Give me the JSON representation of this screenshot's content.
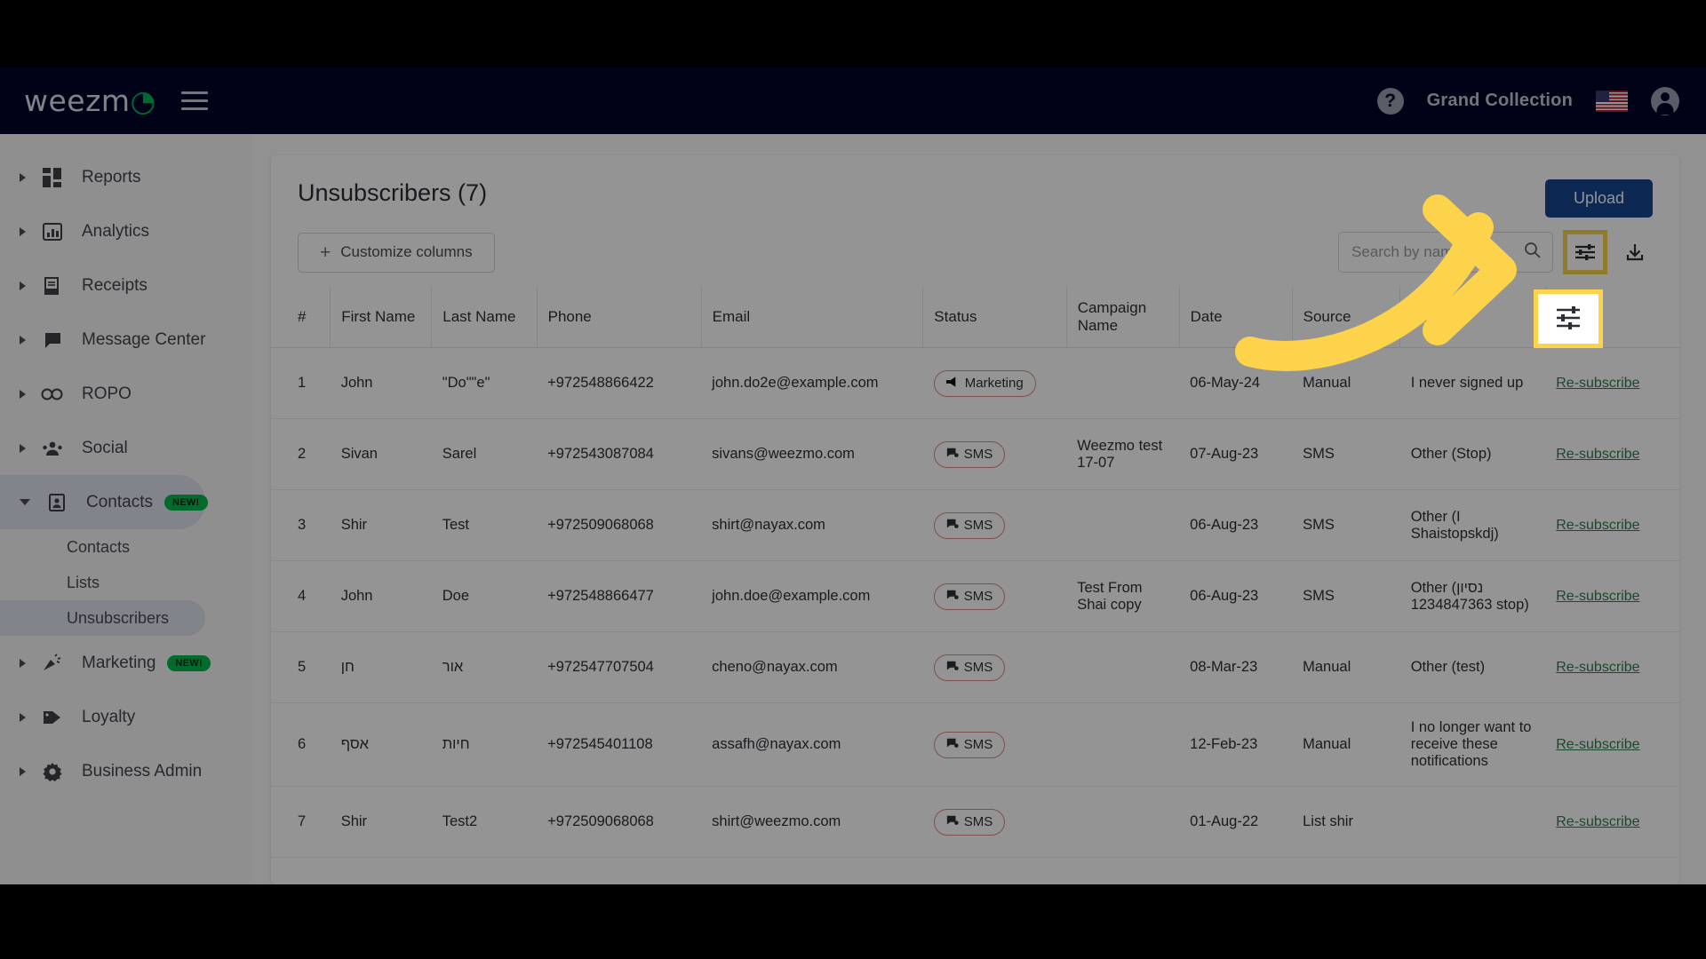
{
  "appbar": {
    "logo_text": "weezm",
    "logo_accent": "◔",
    "menu_icon": "hamburger-icon",
    "help_label": "?",
    "company": "Grand Collection",
    "flag": "us-flag",
    "account_icon": "account-icon"
  },
  "sidebar": {
    "items": [
      {
        "label": "Reports",
        "icon": "dashboard-icon",
        "expanded": false,
        "badge": ""
      },
      {
        "label": "Analytics",
        "icon": "bar-chart-icon",
        "expanded": false,
        "badge": ""
      },
      {
        "label": "Receipts",
        "icon": "receipt-icon",
        "expanded": false,
        "badge": ""
      },
      {
        "label": "Message Center",
        "icon": "chat-icon",
        "expanded": false,
        "badge": ""
      },
      {
        "label": "ROPO",
        "icon": "infinity-icon",
        "expanded": false,
        "badge": ""
      },
      {
        "label": "Social",
        "icon": "people-icon",
        "expanded": false,
        "badge": ""
      },
      {
        "label": "Contacts",
        "icon": "contact-card-icon",
        "expanded": true,
        "badge": "NEW!"
      },
      {
        "label": "Marketing",
        "icon": "megaphone-party-icon",
        "expanded": false,
        "badge": "NEW!"
      },
      {
        "label": "Loyalty",
        "icon": "tag-heart-icon",
        "expanded": false,
        "badge": ""
      },
      {
        "label": "Business Admin",
        "icon": "gear-icon",
        "expanded": false,
        "badge": ""
      }
    ],
    "contacts_children": [
      {
        "label": "Contacts",
        "active": false
      },
      {
        "label": "Lists",
        "active": false
      },
      {
        "label": "Unsubscribers",
        "active": true
      }
    ]
  },
  "main": {
    "title": "Unsubscribers (7)",
    "upload_label": "Upload",
    "customize_label": "Customize columns",
    "search": {
      "value": "",
      "placeholder": "Search by name"
    },
    "filter_icon": "filter-sliders-icon",
    "download_icon": "download-icon",
    "highlight_color": "#fcd34a",
    "accent_color": "#15468f",
    "link_color": "#2e7d4f"
  },
  "table": {
    "columns": [
      "#",
      "First Name",
      "Last Name",
      "Phone",
      "Email",
      "Status",
      "Campaign Name",
      "Date",
      "Source",
      "Reason",
      ""
    ],
    "rows": [
      {
        "num": "1",
        "first": "John",
        "last": "\"Do\"\"e\"",
        "phone": "+972548866422",
        "email": "john.do2e@example.com",
        "status": "Marketing",
        "status_icon": "megaphone-icon",
        "campaign": "",
        "date": "06-May-24",
        "source": "Manual",
        "reason": "I never signed up",
        "action": "Re-subscribe"
      },
      {
        "num": "2",
        "first": "Sivan",
        "last": "Sarel",
        "phone": "+972543087084",
        "email": "sivans@weezmo.com",
        "status": "SMS",
        "status_icon": "sms-icon",
        "campaign": "Weezmo test 17-07",
        "date": "07-Aug-23",
        "source": "SMS",
        "reason": "Other (Stop)",
        "action": "Re-subscribe"
      },
      {
        "num": "3",
        "first": "Shir",
        "last": "Test",
        "phone": "+972509068068",
        "email": "shirt@nayax.com",
        "status": "SMS",
        "status_icon": "sms-icon",
        "campaign": "",
        "date": "06-Aug-23",
        "source": "SMS",
        "reason": "Other (I Shaistopskdj)",
        "action": "Re-subscribe"
      },
      {
        "num": "4",
        "first": "John",
        "last": "Doe",
        "phone": "+972548866477",
        "email": "john.doe@example.com",
        "status": "SMS",
        "status_icon": "sms-icon",
        "campaign": "Test From Shai copy",
        "date": "06-Aug-23",
        "source": "SMS",
        "reason": "Other (נסיון 1234847363 stop)",
        "action": "Re-subscribe"
      },
      {
        "num": "5",
        "first": "חן",
        "last": "אור",
        "phone": "+972547707504",
        "email": "cheno@nayax.com",
        "status": "SMS",
        "status_icon": "sms-icon",
        "campaign": "",
        "date": "08-Mar-23",
        "source": "Manual",
        "reason": "Other (test)",
        "action": "Re-subscribe"
      },
      {
        "num": "6",
        "first": "אסף",
        "last": "חיות",
        "phone": "+972545401108",
        "email": "assafh@nayax.com",
        "status": "SMS",
        "status_icon": "sms-icon",
        "campaign": "",
        "date": "12-Feb-23",
        "source": "Manual",
        "reason": "I no longer want to receive these notifications",
        "action": "Re-subscribe"
      },
      {
        "num": "7",
        "first": "Shir",
        "last": "Test2",
        "phone": "+972509068068",
        "email": "shirt@weezmo.com",
        "status": "SMS",
        "status_icon": "sms-icon",
        "campaign": "",
        "date": "01-Aug-22",
        "source": "List shir",
        "reason": "",
        "action": "Re-subscribe"
      }
    ]
  },
  "annotation": {
    "arrow": "curved-arrow-right",
    "arrow_color": "#fcd34a",
    "target": "filter-sliders-icon"
  }
}
